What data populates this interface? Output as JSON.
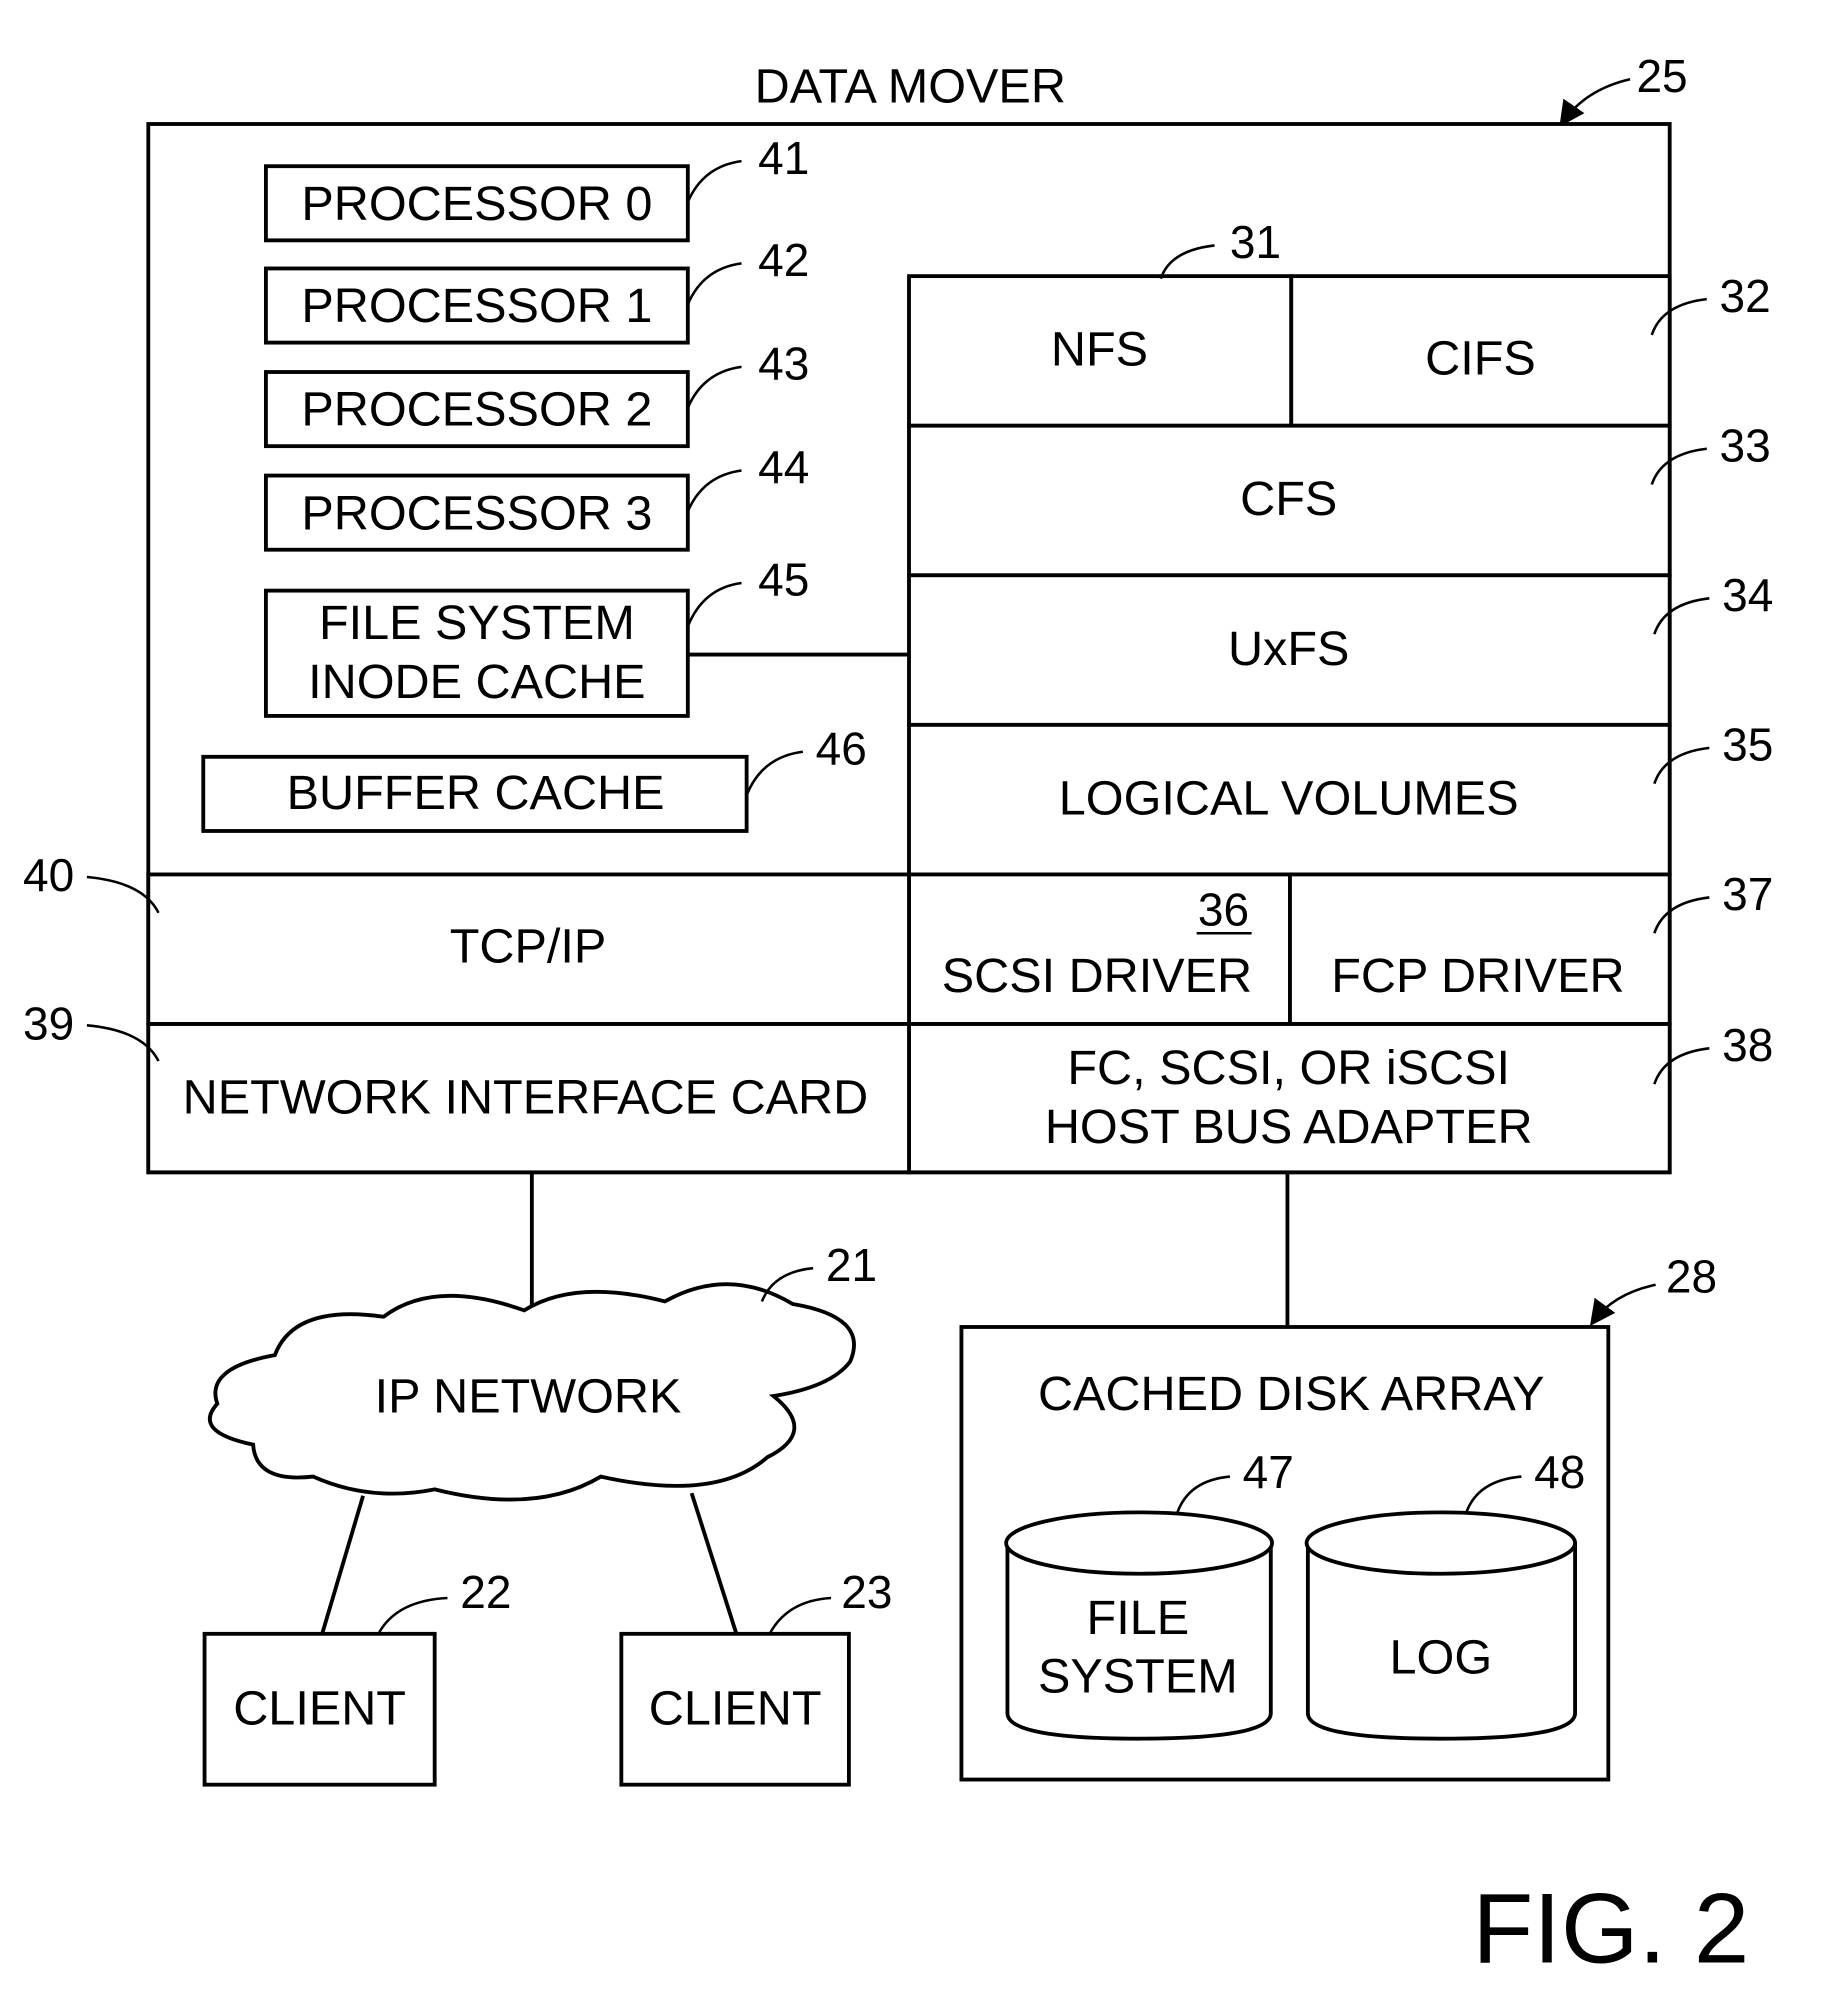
{
  "title": "DATA MOVER",
  "figure_label": "FIG. 2",
  "data_mover": {
    "ref": "25",
    "processors": [
      {
        "label": "PROCESSOR 0",
        "ref": "41"
      },
      {
        "label": "PROCESSOR 1",
        "ref": "42"
      },
      {
        "label": "PROCESSOR 2",
        "ref": "43"
      },
      {
        "label": "PROCESSOR 3",
        "ref": "44"
      }
    ],
    "inode_cache": {
      "lines": [
        "FILE SYSTEM",
        "INODE CACHE"
      ],
      "ref": "45"
    },
    "buffer_cache": {
      "label": "BUFFER CACHE",
      "ref": "46"
    },
    "stack": {
      "nfs": {
        "label": "NFS",
        "ref": "31"
      },
      "cifs": {
        "label": "CIFS",
        "ref": "32"
      },
      "cfs": {
        "label": "CFS",
        "ref": "33"
      },
      "uxfs": {
        "label": "UxFS",
        "ref": "34"
      },
      "logical_volumes": {
        "label": "LOGICAL VOLUMES",
        "ref": "35"
      },
      "scsi_driver": {
        "label": "SCSI DRIVER",
        "ref": "36"
      },
      "fcp_driver": {
        "label": "FCP DRIVER",
        "ref": "37"
      },
      "hba": {
        "lines": [
          "FC, SCSI, OR iSCSI",
          "HOST BUS ADAPTER"
        ],
        "ref": "38"
      }
    },
    "tcpip": {
      "label": "TCP/IP",
      "ref": "40"
    },
    "nic": {
      "label": "NETWORK INTERFACE CARD",
      "ref": "39"
    }
  },
  "ip_network": {
    "label": "IP NETWORK",
    "ref": "21"
  },
  "clients": [
    {
      "label": "CLIENT",
      "ref": "22"
    },
    {
      "label": "CLIENT",
      "ref": "23"
    }
  ],
  "disk_array": {
    "label": "CACHED DISK ARRAY",
    "ref": "28",
    "disks": [
      {
        "lines": [
          "FILE",
          "SYSTEM"
        ],
        "ref": "47"
      },
      {
        "lines": [
          "LOG"
        ],
        "ref": "48"
      }
    ]
  }
}
